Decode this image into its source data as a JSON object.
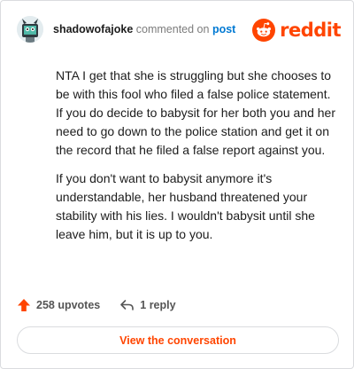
{
  "comment": {
    "username": "shadowofajoke",
    "action_text": "commented on",
    "post_link": "post",
    "paragraphs": [
      "NTA I get that she is struggling but she chooses to be with this fool who filed a false police statement. If you do decide to babysit for her both you and her need to go down to the police station and get it on the record that he filed a false report against you.",
      "If you don't want to babysit anymore it's understandable, her husband threatened your stability with his lies. I wouldn't babysit until she leave him, but it is up to you."
    ]
  },
  "brand": {
    "name": "reddit",
    "color": "#ff4500",
    "icon": "reddit-snoo-icon"
  },
  "stats": {
    "upvotes": "258 upvotes",
    "replies": "1 reply",
    "upvote_icon": "upvote-arrow-icon",
    "reply_icon": "reply-arrow-icon",
    "upvote_color": "#ff4500"
  },
  "cta": {
    "label": "View the conversation",
    "color": "#ff4500"
  }
}
